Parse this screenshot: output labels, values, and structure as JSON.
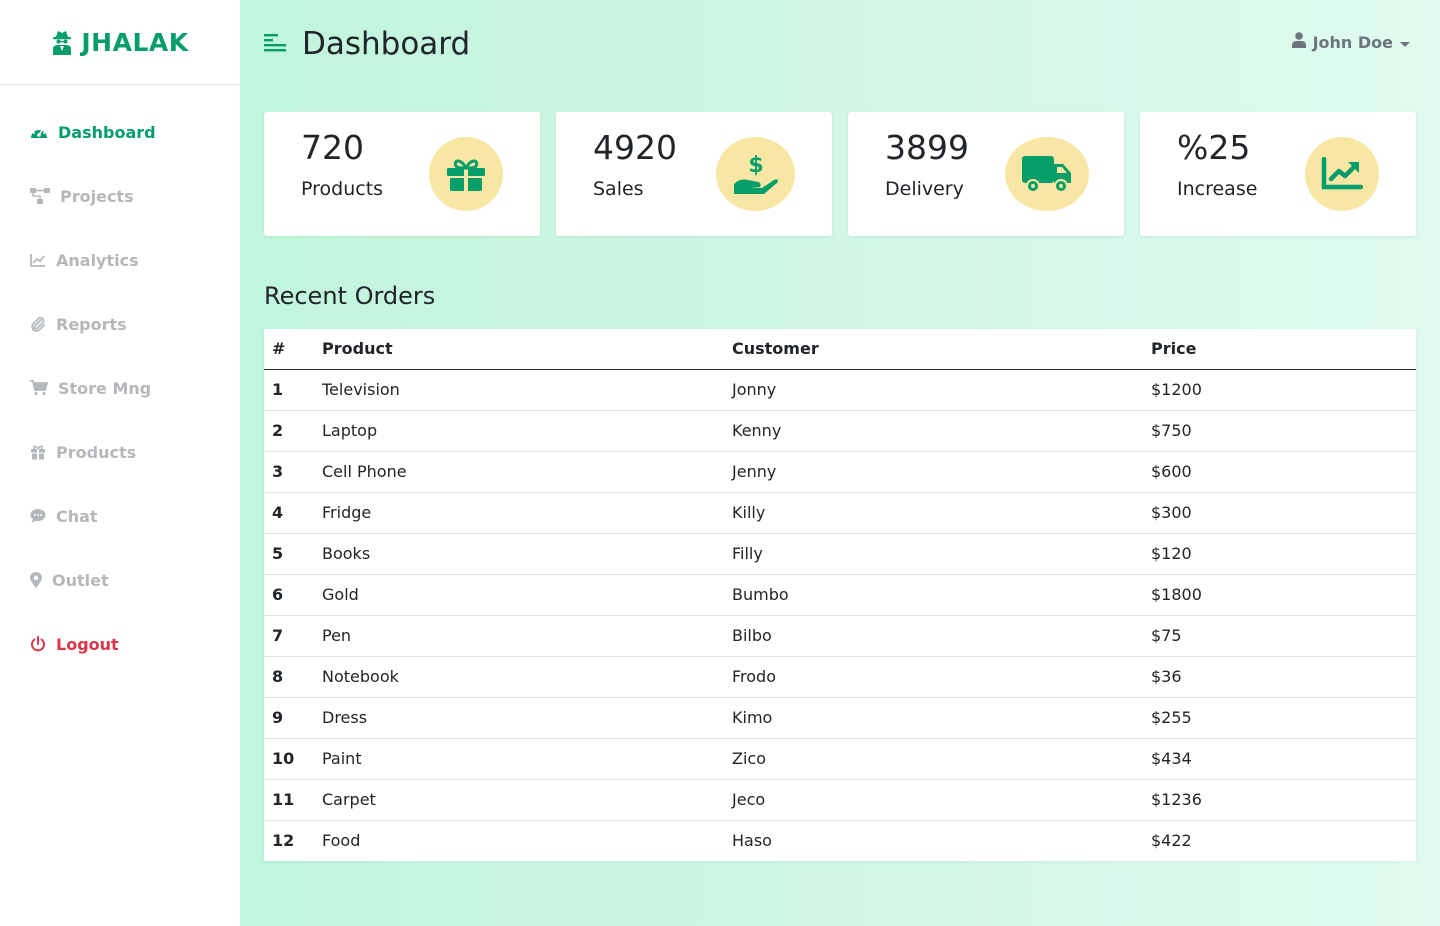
{
  "brand": {
    "name": "JHALAK",
    "color": "#059e6a"
  },
  "sidebar": {
    "items": [
      {
        "label": "Dashboard",
        "icon": "gauge-icon",
        "state": "active"
      },
      {
        "label": "Projects",
        "icon": "sitemap-icon"
      },
      {
        "label": "Analytics",
        "icon": "line-chart-icon"
      },
      {
        "label": "Reports",
        "icon": "paperclip-icon"
      },
      {
        "label": "Store Mng",
        "icon": "cart-icon"
      },
      {
        "label": "Products",
        "icon": "gift-icon"
      },
      {
        "label": "Chat",
        "icon": "comment-icon"
      },
      {
        "label": "Outlet",
        "icon": "map-marker-icon"
      },
      {
        "label": "Logout",
        "icon": "power-icon",
        "state": "danger"
      }
    ]
  },
  "header": {
    "title": "Dashboard",
    "user_name": "John Doe"
  },
  "stats": [
    {
      "value": "720",
      "label": "Products",
      "icon": "gift-icon"
    },
    {
      "value": "4920",
      "label": "Sales",
      "icon": "hand-dollar-icon"
    },
    {
      "value": "3899",
      "label": "Delivery",
      "icon": "truck-icon"
    },
    {
      "value": "%25",
      "label": "Increase",
      "icon": "chart-up-icon"
    }
  ],
  "orders": {
    "title": "Recent Orders",
    "columns": [
      "#",
      "Product",
      "Customer",
      "Price"
    ],
    "rows": [
      [
        "1",
        "Television",
        "Jonny",
        "$1200"
      ],
      [
        "2",
        "Laptop",
        "Kenny",
        "$750"
      ],
      [
        "3",
        "Cell Phone",
        "Jenny",
        "$600"
      ],
      [
        "4",
        "Fridge",
        "Killy",
        "$300"
      ],
      [
        "5",
        "Books",
        "Filly",
        "$120"
      ],
      [
        "6",
        "Gold",
        "Bumbo",
        "$1800"
      ],
      [
        "7",
        "Pen",
        "Bilbo",
        "$75"
      ],
      [
        "8",
        "Notebook",
        "Frodo",
        "$36"
      ],
      [
        "9",
        "Dress",
        "Kimo",
        "$255"
      ],
      [
        "10",
        "Paint",
        "Zico",
        "$434"
      ],
      [
        "11",
        "Carpet",
        "Jeco",
        "$1236"
      ],
      [
        "12",
        "Food",
        "Haso",
        "$422"
      ]
    ]
  },
  "colors": {
    "accent": "#059e6a",
    "icon_circle": "#f8e7a4",
    "muted": "#b5b8bb",
    "danger": "#dc3545"
  }
}
